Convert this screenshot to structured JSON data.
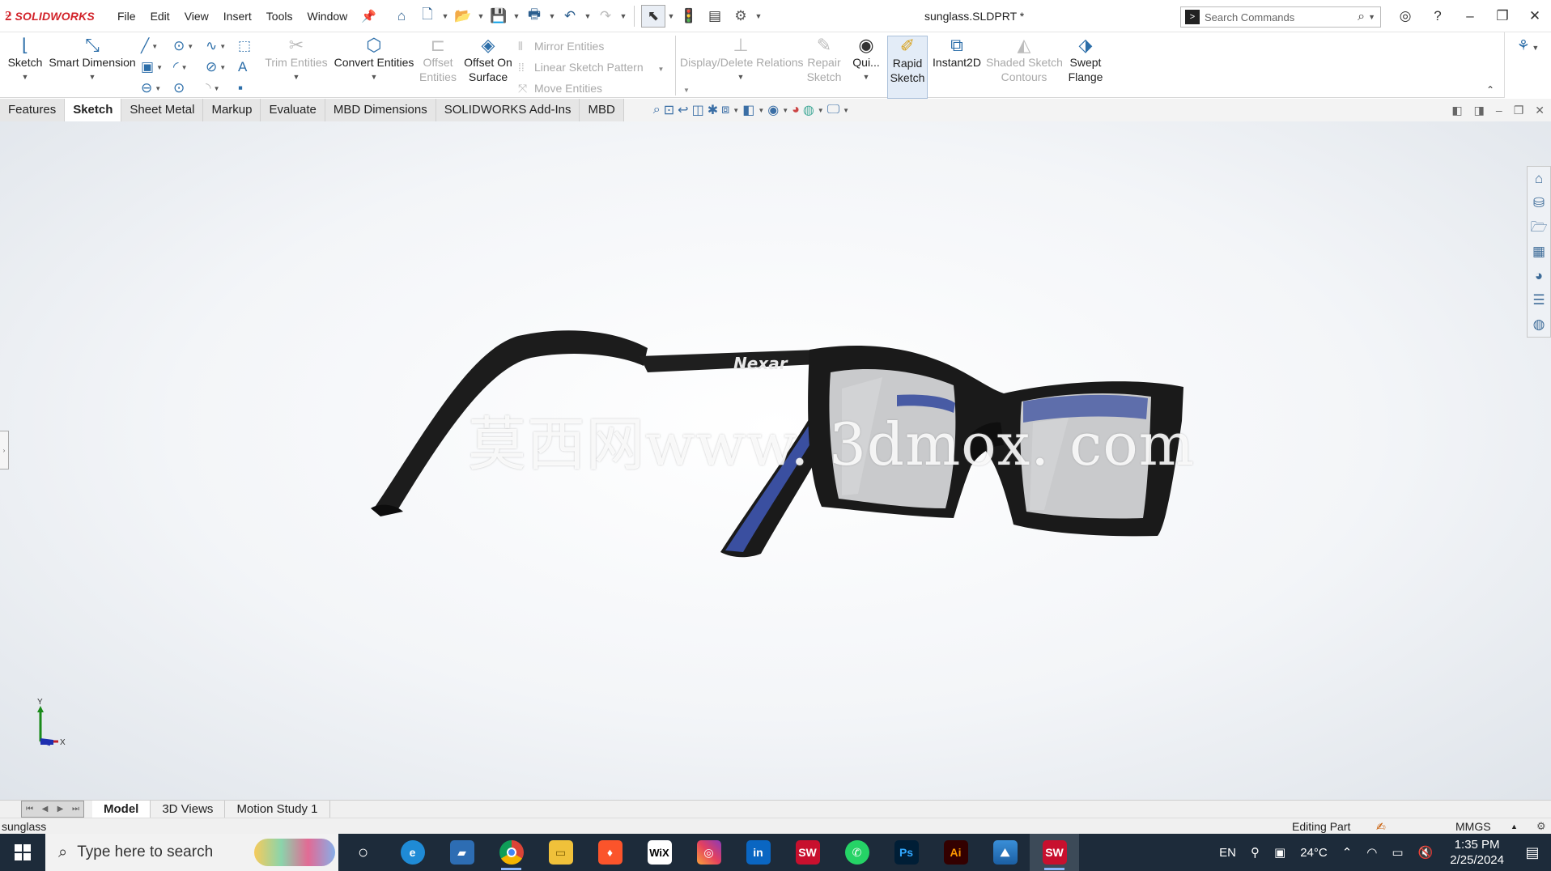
{
  "app": {
    "logo_text": "SOLIDWORKS",
    "doc_title": "sunglass.SLDPRT *",
    "menu": [
      "File",
      "Edit",
      "View",
      "Insert",
      "Tools",
      "Window"
    ],
    "search_placeholder": "Search Commands"
  },
  "commands": {
    "sketch": "Sketch",
    "smart_dimension": "Smart Dimension",
    "trim_entities": "Trim Entities",
    "convert_entities": "Convert Entities",
    "offset_entities_1": "Offset",
    "offset_entities_2": "Entities",
    "offset_on_surface_1": "Offset On",
    "offset_on_surface_2": "Surface",
    "mirror_entities": "Mirror Entities",
    "linear_sketch_pattern": "Linear Sketch Pattern",
    "move_entities": "Move Entities",
    "display_delete_relations": "Display/Delete Relations",
    "repair_sketch_1": "Repair",
    "repair_sketch_2": "Sketch",
    "quick_snaps": "Qui...",
    "rapid_sketch_1": "Rapid",
    "rapid_sketch_2": "Sketch",
    "instant2d": "Instant2D",
    "shaded_sketch_contours_1": "Shaded Sketch",
    "shaded_sketch_contours_2": "Contours",
    "swept_flange_1": "Swept",
    "swept_flange_2": "Flange"
  },
  "tabs": [
    "Features",
    "Sketch",
    "Sheet Metal",
    "Markup",
    "Evaluate",
    "MBD Dimensions",
    "SOLIDWORKS Add-Ins",
    "MBD"
  ],
  "active_tab": "Sketch",
  "viewport": {
    "watermark": "莫西网www. 3dmox. com",
    "frame_logo": "Nexar",
    "triad_y": "Y",
    "triad_x": "X",
    "frame_color": "#1c1c1c",
    "temple_accent_color": "#3a4fa0",
    "lens_color": "#c9cacc"
  },
  "model_tabs": [
    "Model",
    "3D Views",
    "Motion Study 1"
  ],
  "status": {
    "part_name": "sunglass",
    "editing": "Editing Part",
    "units": "MMGS"
  },
  "taskbar": {
    "search_placeholder": "Type here to search",
    "language": "EN",
    "temperature": "24°C",
    "time": "1:35 PM",
    "date": "2/25/2024"
  }
}
